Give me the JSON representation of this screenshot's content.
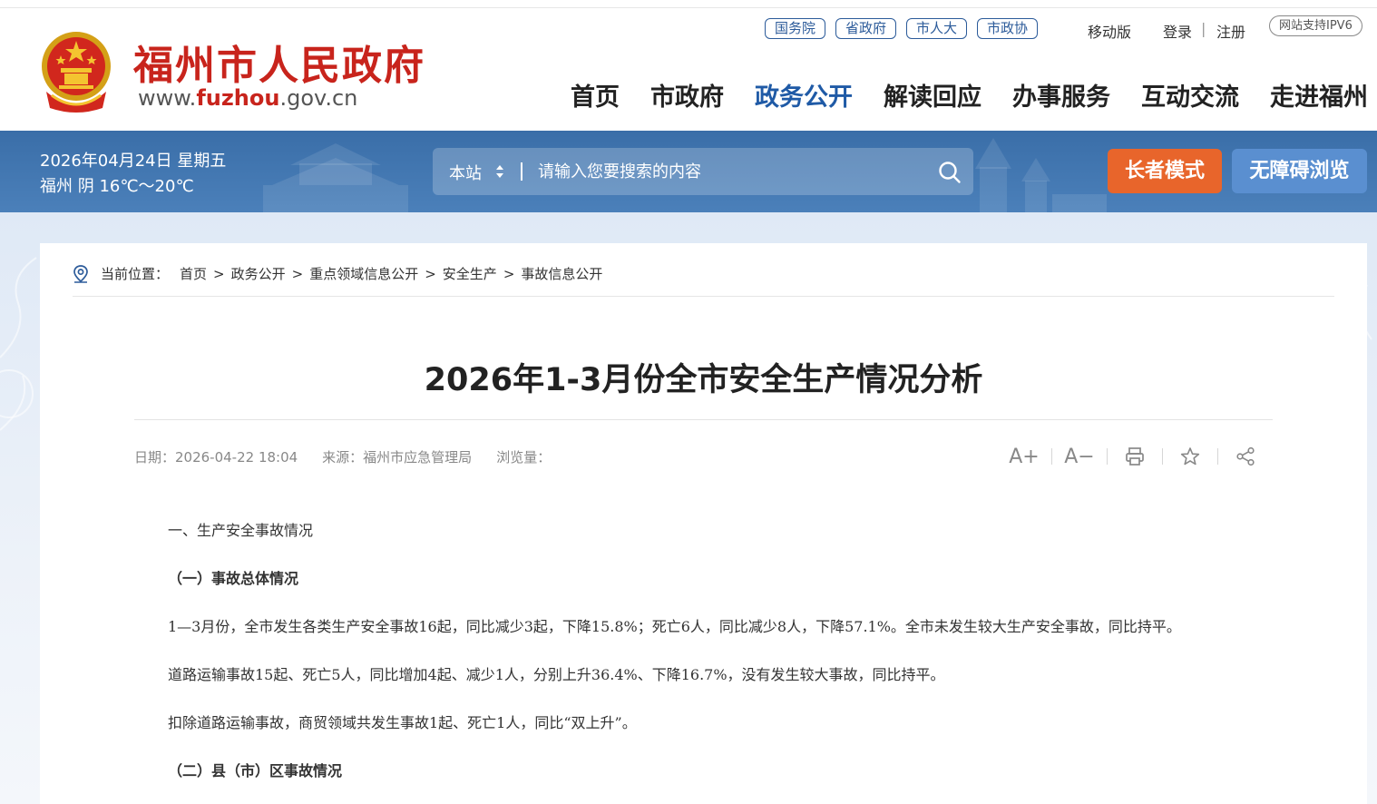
{
  "header": {
    "site_name": "福州市人民政府",
    "domain_prefix": "www.",
    "domain_highlight": "fuzhou",
    "domain_suffix": ".gov.cn",
    "gov_links": [
      {
        "label": "国务院"
      },
      {
        "label": "省政府"
      },
      {
        "label": "市人大"
      },
      {
        "label": "市政协"
      }
    ],
    "mobile": "移动版",
    "login": "登录",
    "separator": "|",
    "register": "注册",
    "ipv6": "网站支持IPV6",
    "nav": [
      {
        "label": "首页"
      },
      {
        "label": "市政府"
      },
      {
        "label": "政务公开"
      },
      {
        "label": "解读回应"
      },
      {
        "label": "办事服务"
      },
      {
        "label": "互动交流"
      },
      {
        "label": "走进福州"
      }
    ],
    "active_nav": "政务公开"
  },
  "banner": {
    "date": "2026年04月24日 星期五",
    "weather": "福州 阴 16℃～20℃",
    "search_scope": "本站",
    "search_placeholder": "请输入您要搜索的内容",
    "elder_mode": "长者模式",
    "accessible": "无障碍浏览"
  },
  "breadcrumb": {
    "label": "当前位置：",
    "items": [
      {
        "label": "首页"
      },
      {
        "label": "政务公开"
      },
      {
        "label": "重点领域信息公开"
      },
      {
        "label": "安全生产"
      },
      {
        "label": "事故信息公开"
      }
    ],
    "sep": ">"
  },
  "article": {
    "title": "2026年1-3月份全市安全生产情况分析",
    "date": "日期：2026-04-22 18:04",
    "source": "来源：福州市应急管理局",
    "views": "浏览量：",
    "tools": {
      "font_up": "A+",
      "font_down": "A−"
    },
    "heading1": "一、生产安全事故情况",
    "subheading1": "（一）事故总体情况",
    "para1": "1—3月份，全市发生各类生产安全事故16起，同比减少3起，下降15.8%；死亡6人，同比减少8人，下降57.1%。全市未发生较大生产安全事故，同比持平。",
    "para2": "道路运输事故15起、死亡5人，同比增加4起、减少1人，分别上升36.4%、下降16.7%，没有发生较大事故，同比持平。",
    "para3": "扣除道路运输事故，商贸领域共发生事故1起、死亡1人，同比“双上升”。",
    "subheading2": "（二）县（市）区事故情况"
  },
  "colors": {
    "brand_red": "#c8241c",
    "nav_active": "#1f5aa6",
    "banner": "#3a6ea8",
    "elder_button": "#e8652b",
    "accessible_button": "#5a8fd0"
  }
}
